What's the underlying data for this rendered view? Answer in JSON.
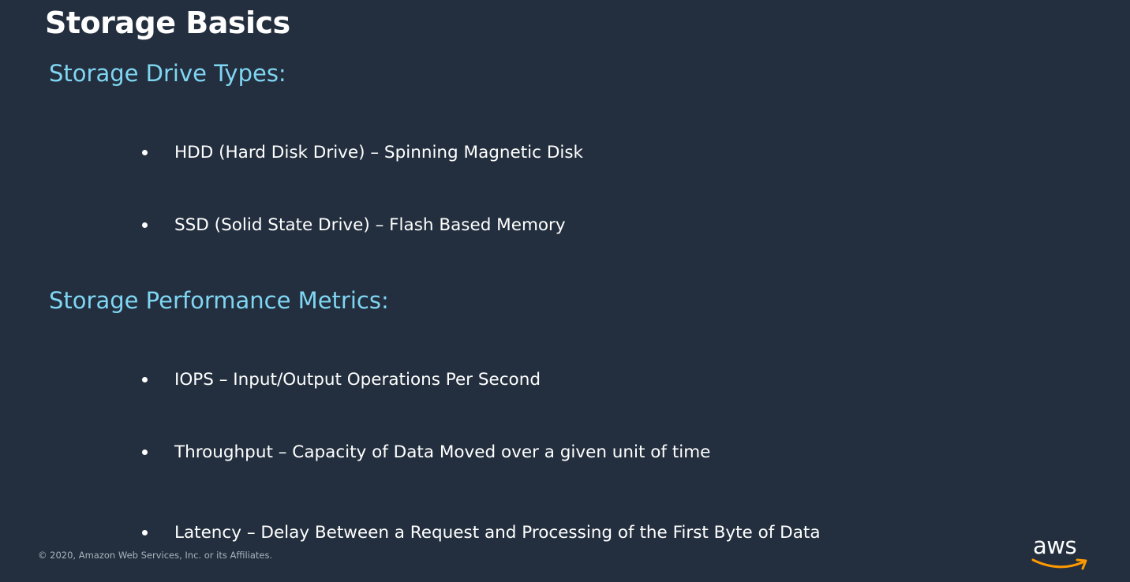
{
  "slide": {
    "title": "Storage Basics",
    "sections": [
      {
        "heading": "Storage Drive Types:",
        "bullets": [
          "HDD (Hard Disk Drive) – Spinning Magnetic Disk",
          "SSD (Solid State Drive) – Flash Based Memory"
        ]
      },
      {
        "heading": "Storage Performance Metrics:",
        "bullets": [
          "IOPS – Input/Output Operations Per Second",
          "Throughput – Capacity of Data Moved over a given unit of time",
          "Latency – Delay Between a Request and Processing of the First Byte of Data"
        ]
      }
    ],
    "footer": "© 2020, Amazon Web Services, Inc. or its Affiliates.",
    "logo": {
      "text": "aws",
      "icon": "aws-smile-arrow-icon",
      "accent_color": "#ff9900"
    }
  },
  "colors": {
    "background": "#232f3e",
    "heading": "#7fd6f3",
    "text": "#ffffff"
  }
}
